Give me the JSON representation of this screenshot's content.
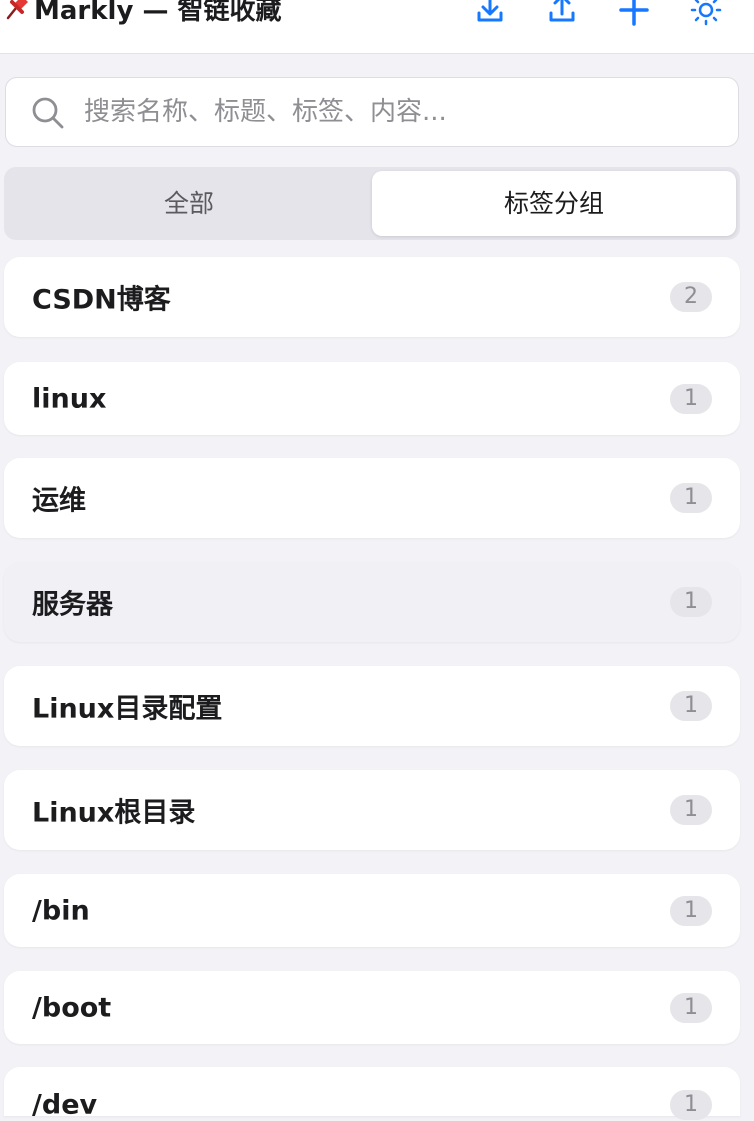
{
  "header": {
    "title": "Markly — 智链收藏",
    "icons": {
      "pin": "pushpin-icon",
      "import": "download-icon",
      "export": "upload-icon",
      "add": "plus-icon",
      "settings": "sun-icon"
    },
    "accent_color": "#1677ff"
  },
  "search": {
    "placeholder": "搜索名称、标题、标签、内容..."
  },
  "tabs": [
    {
      "label": "全部",
      "active": false
    },
    {
      "label": "标签分组",
      "active": true
    }
  ],
  "groups": [
    {
      "name": "CSDN博客",
      "count": "2"
    },
    {
      "name": "linux",
      "count": "1"
    },
    {
      "name": "运维",
      "count": "1"
    },
    {
      "name": "服务器",
      "count": "1"
    },
    {
      "name": "Linux目录配置",
      "count": "1"
    },
    {
      "name": "Linux根目录",
      "count": "1"
    },
    {
      "name": "/bin",
      "count": "1"
    },
    {
      "name": "/boot",
      "count": "1"
    },
    {
      "name": "/dev",
      "count": "1"
    }
  ]
}
